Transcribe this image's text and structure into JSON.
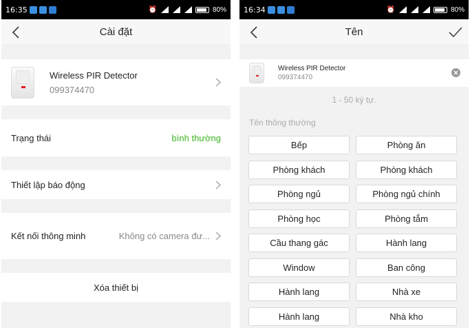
{
  "left": {
    "status": {
      "time": "16:35",
      "battery": "80%"
    },
    "title": "Cài đặt",
    "device": {
      "name": "Wireless PIR Detector",
      "id": "099374470"
    },
    "status_row": {
      "label": "Trạng thái",
      "value": "bình thường",
      "value_color": "#3cb521"
    },
    "alarm_row": {
      "label": "Thiết lập báo động"
    },
    "smart_row": {
      "label": "Kết nối thông minh",
      "value": "Không có camera đư..."
    },
    "delete_label": "Xóa thiết bị"
  },
  "right": {
    "status": {
      "time": "16:34",
      "battery": "80%"
    },
    "title": "Tên",
    "device": {
      "name": "Wireless PIR Detector",
      "id": "099374470"
    },
    "hint": "1 - 50 ký tự.",
    "section_label": "Tên thông thường",
    "names": [
      "Bếp",
      "Phòng ăn",
      "Phòng khách",
      "Phòng khách",
      "Phòng ngủ",
      "Phòng ngủ chính",
      "Phòng học",
      "Phòng tắm",
      "Cầu thang gác",
      "Hành lang",
      "Window",
      "Ban công",
      "Hành lang",
      "Nhà xe",
      "Hành lang",
      "Nhà kho"
    ]
  }
}
